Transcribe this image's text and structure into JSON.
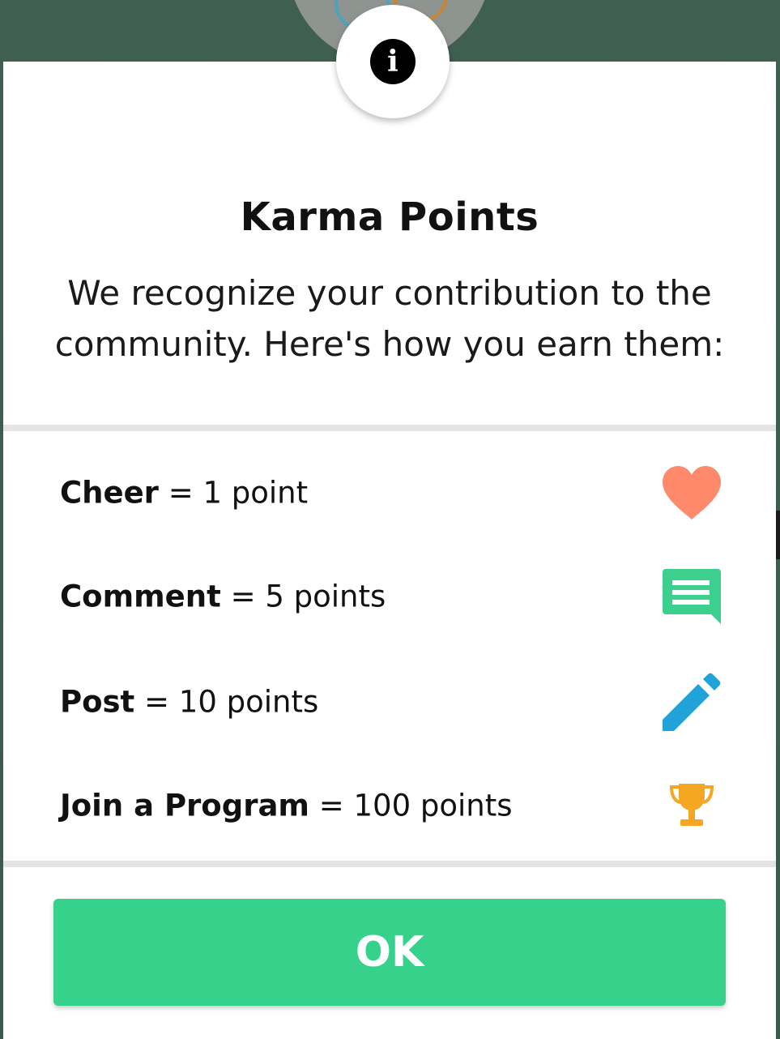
{
  "modal": {
    "title": "Karma Points",
    "subtitle": "We recognize your contribution to the community. Here's how you earn them:",
    "info_icon": "info-icon",
    "rules": [
      {
        "action": "Cheer",
        "points": "= 1 point",
        "icon": "heart-icon",
        "icon_color": "#ff8a6b"
      },
      {
        "action": "Comment",
        "points": "= 5 points",
        "icon": "comment-icon",
        "icon_color": "#3ccf8e"
      },
      {
        "action": "Post",
        "points": "= 10 points",
        "icon": "pencil-icon",
        "icon_color": "#1fa3d8"
      },
      {
        "action": "Join a Program",
        "points": "= 100 points",
        "icon": "trophy-icon",
        "icon_color": "#f5a623"
      }
    ],
    "ok_label": "OK",
    "accent_color": "#36d18b"
  }
}
